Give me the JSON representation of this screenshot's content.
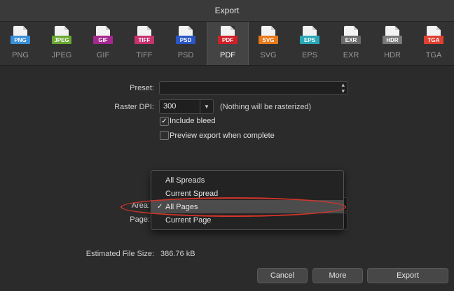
{
  "window": {
    "title": "Export"
  },
  "formats": [
    {
      "tag": "PNG",
      "label": "PNG",
      "color": "#3a8fd8",
      "active": false
    },
    {
      "tag": "JPEG",
      "label": "JPEG",
      "color": "#6aa832",
      "active": false
    },
    {
      "tag": "GIF",
      "label": "GIF",
      "color": "#a5288f",
      "active": false
    },
    {
      "tag": "TIFF",
      "label": "TIFF",
      "color": "#c8326e",
      "active": false
    },
    {
      "tag": "PSD",
      "label": "PSD",
      "color": "#2a56c7",
      "active": false
    },
    {
      "tag": "PDF",
      "label": "PDF",
      "color": "#d0202a",
      "active": true
    },
    {
      "tag": "SVG",
      "label": "SVG",
      "color": "#e87a1a",
      "active": false
    },
    {
      "tag": "EPS",
      "label": "EPS",
      "color": "#2aa8b8",
      "active": false
    },
    {
      "tag": "EXR",
      "label": "EXR",
      "color": "#6b6b6b",
      "active": false
    },
    {
      "tag": "HDR",
      "label": "HDR",
      "color": "#7a7a7a",
      "active": false
    },
    {
      "tag": "TGA",
      "label": "TGA",
      "color": "#e04030",
      "active": false
    }
  ],
  "form": {
    "preset_label": "Preset:",
    "preset_value": "",
    "raster_dpi_label": "Raster DPI:",
    "raster_dpi_value": "300",
    "raster_note": "(Nothing will be rasterized)",
    "include_bleed": {
      "label": "Include bleed",
      "checked": true
    },
    "preview_export": {
      "label": "Preview export when complete",
      "checked": false
    },
    "area_label": "Area:",
    "page_label": "Page:",
    "estimated_label": "Estimated File Size:",
    "estimated_value": "386.76 kB"
  },
  "area_menu": {
    "items": [
      "All Spreads",
      "Current Spread",
      "All Pages",
      "Current Page"
    ],
    "selected": "All Pages"
  },
  "buttons": {
    "cancel": "Cancel",
    "more": "More",
    "export": "Export"
  },
  "accent": {
    "annotation": "#d1352b"
  }
}
